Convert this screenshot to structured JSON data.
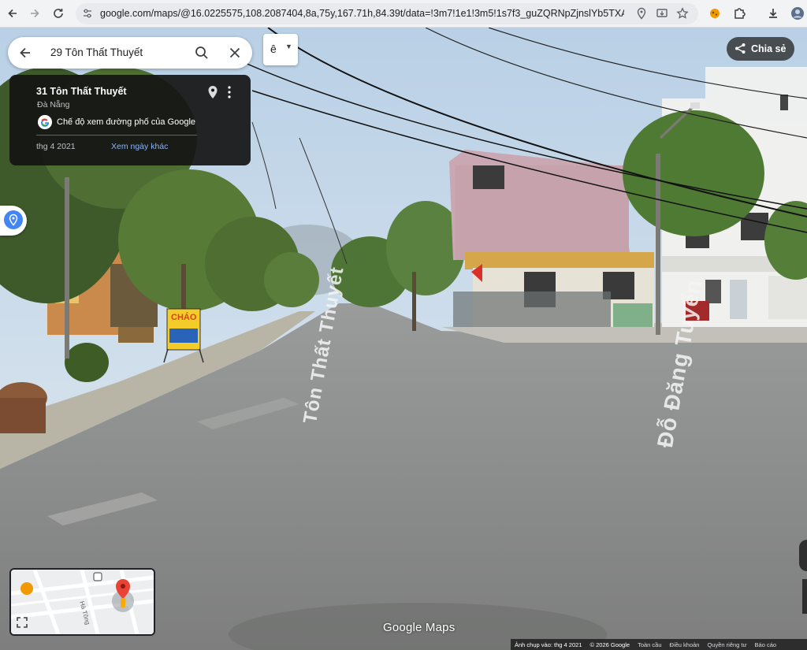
{
  "browser": {
    "url": "google.com/maps/@16.0225575,108.2087404,8a,75y,167.71h,84.39t/data=!3m7!1e1!3m5!1s7f3_guZQRNpZjnslYb5TXA!2e0!6shtt..."
  },
  "search": {
    "query": "29 Tôn Thất Thuyết"
  },
  "language_toggle": {
    "label": "ê"
  },
  "info_card": {
    "title": "31 Tôn Thất Thuyết",
    "subtitle": "Đà Nẵng",
    "google_mode": "Chế độ xem đường phố của Google",
    "capture_date": "thg 4 2021",
    "other_dates_link": "Xem ngày khác"
  },
  "share": {
    "label": "Chia sẻ"
  },
  "street_labels": {
    "left": "Tôn Thất Thuyết",
    "right": "Đỗ Đăng Tuyển"
  },
  "shop_sign": {
    "text": "CHÁO"
  },
  "minimap": {
    "street_label": "Hà Tông"
  },
  "branding": {
    "logo": "Google Maps"
  },
  "footer": {
    "captured": "Ảnh chụp vào: thg 4 2021",
    "copyright": "© 2026 Google",
    "global": "Toàn cầu",
    "terms": "Điều khoản",
    "privacy": "Quyền riêng tư",
    "report": "Báo cáo"
  },
  "colors": {
    "accent_blue": "#4285f4",
    "link_blue": "#8ab4f8",
    "card_bg": "#141414",
    "pin_red": "#ea4335"
  }
}
